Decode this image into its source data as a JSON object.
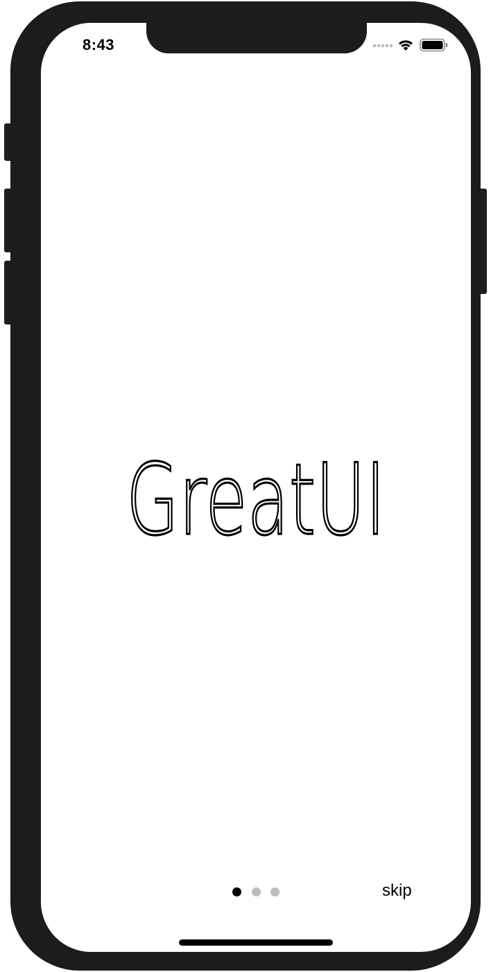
{
  "status_bar": {
    "time": "8:43",
    "signal_icon": "signal-dots-icon",
    "wifi_icon": "wifi-icon",
    "battery_icon": "battery-icon"
  },
  "onboarding": {
    "logo_text": "GreatUI",
    "page_indicator": {
      "total_pages": 3,
      "current_page": 1,
      "active_color": "#000000",
      "inactive_color": "#bdbdbd"
    },
    "skip_label": "skip"
  },
  "device": {
    "frame_color": "#1c1c1c",
    "screen_color": "#ffffff"
  }
}
